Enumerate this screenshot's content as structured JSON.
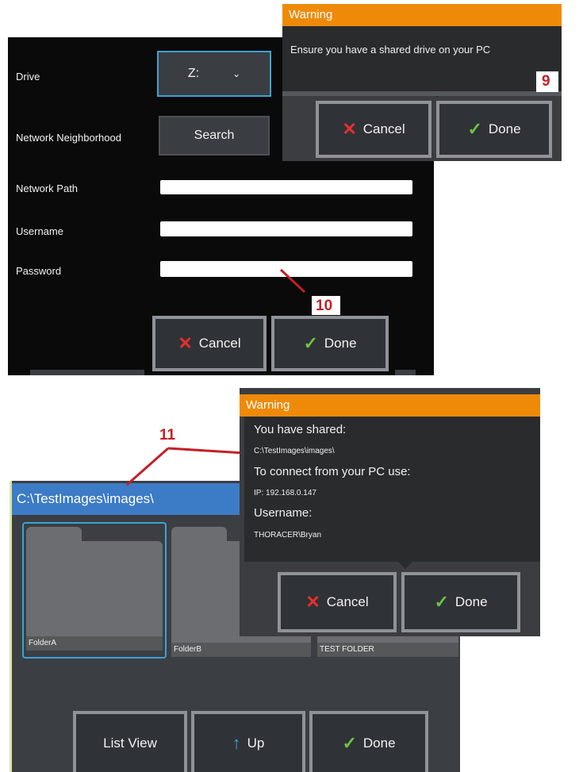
{
  "panel1": {
    "drive_label": "Drive",
    "drive_value": "Z:",
    "network_neighborhood_label": "Network Neighborhood",
    "search_button": "Search",
    "network_path_label": "Network Path",
    "username_label": "Username",
    "password_label": "Password",
    "network_path_value": "",
    "username_value": "",
    "password_value": "",
    "cancel_button": "Cancel",
    "done_button": "Done"
  },
  "warning1": {
    "title": "Warning",
    "message": "Ensure you have a shared drive on your PC",
    "cancel_button": "Cancel",
    "done_button": "Done"
  },
  "callouts": {
    "c9": "9",
    "c10": "10",
    "c11": "11"
  },
  "browser": {
    "path": "C:\\TestImages\\images\\",
    "folders": [
      "FolderA",
      "FolderB",
      "TEST FOLDER"
    ],
    "list_view_button": "List View",
    "up_button": "Up",
    "done_button": "Done"
  },
  "warning2": {
    "title": "Warning",
    "shared_heading": "You have shared:",
    "shared_path": "C:\\TestImages\\images\\",
    "connect_heading": "To connect from your PC use:",
    "ip": "IP: 192.168.0.147",
    "username_heading": "Username:",
    "username": "THORACER\\Bryan",
    "cancel_button": "Cancel",
    "done_button": "Done"
  },
  "colors": {
    "warning_header": "#ef8a09",
    "path_bar": "#3c7bc6",
    "selection": "#3aa3d6",
    "callout_red": "#c41f26"
  },
  "icons": {
    "dropdown": "chevron-down-icon",
    "cancel": "x-icon",
    "done": "check-icon",
    "up": "up-arrow-icon"
  }
}
